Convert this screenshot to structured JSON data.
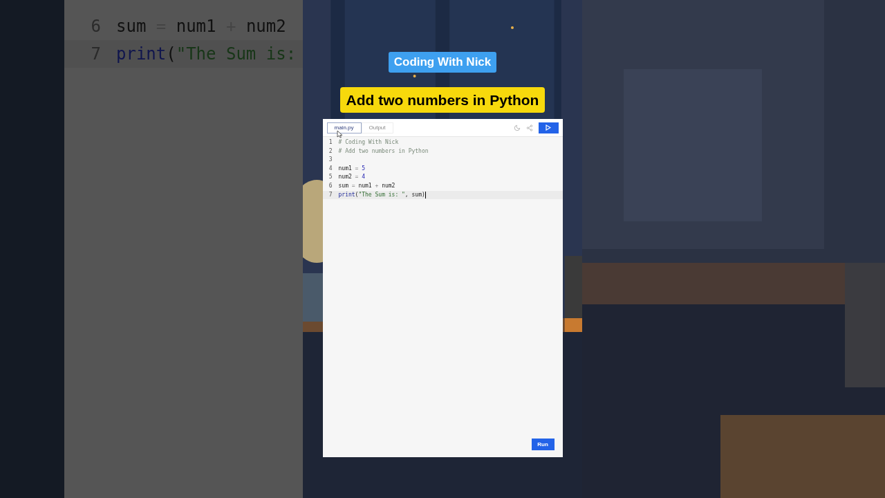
{
  "background_zoom": {
    "lines": [
      {
        "number": "6",
        "tokens": [
          {
            "kind": "name",
            "text": "sum"
          },
          {
            "kind": "op",
            "text": " = "
          },
          {
            "kind": "name",
            "text": "num1"
          },
          {
            "kind": "op",
            "text": " + "
          },
          {
            "kind": "name",
            "text": "num2"
          }
        ]
      },
      {
        "number": "7",
        "tokens": [
          {
            "kind": "builtin",
            "text": "print"
          },
          {
            "kind": "punct",
            "text": "("
          },
          {
            "kind": "string",
            "text": "\"The Sum is:"
          }
        ]
      }
    ]
  },
  "channel_badge": "Coding With Nick",
  "video_title": "Add two numbers in Python",
  "editor": {
    "tabs": [
      {
        "label": "main.py",
        "selected": true
      },
      {
        "label": "Output",
        "selected": false
      }
    ],
    "lines": [
      {
        "number": "1",
        "selected": false,
        "tokens": [
          {
            "kind": "comment",
            "text": "# Coding With Nick"
          }
        ]
      },
      {
        "number": "2",
        "selected": false,
        "tokens": [
          {
            "kind": "comment",
            "text": "# Add two numbers in Python"
          }
        ]
      },
      {
        "number": "3",
        "selected": false
      },
      {
        "number": "4",
        "selected": false,
        "tokens": [
          {
            "kind": "name",
            "text": "num1"
          },
          {
            "kind": "op",
            "text": " = "
          },
          {
            "kind": "number",
            "text": "5"
          }
        ]
      },
      {
        "number": "5",
        "selected": false,
        "tokens": [
          {
            "kind": "name",
            "text": "num2"
          },
          {
            "kind": "op",
            "text": " = "
          },
          {
            "kind": "number",
            "text": "4"
          }
        ]
      },
      {
        "number": "6",
        "selected": false,
        "tokens": [
          {
            "kind": "name",
            "text": "sum"
          },
          {
            "kind": "op",
            "text": " = "
          },
          {
            "kind": "name",
            "text": "num1"
          },
          {
            "kind": "op",
            "text": " + "
          },
          {
            "kind": "name",
            "text": "num2"
          }
        ]
      },
      {
        "number": "7",
        "selected": true,
        "tokens": [
          {
            "kind": "builtin",
            "text": "print"
          },
          {
            "kind": "punct",
            "text": "("
          },
          {
            "kind": "string",
            "text": "\"The Sum is: \""
          },
          {
            "kind": "punct",
            "text": ", "
          },
          {
            "kind": "name",
            "text": "sum"
          },
          {
            "kind": "punct",
            "text": ")"
          }
        ]
      }
    ],
    "run_label": "Run"
  }
}
